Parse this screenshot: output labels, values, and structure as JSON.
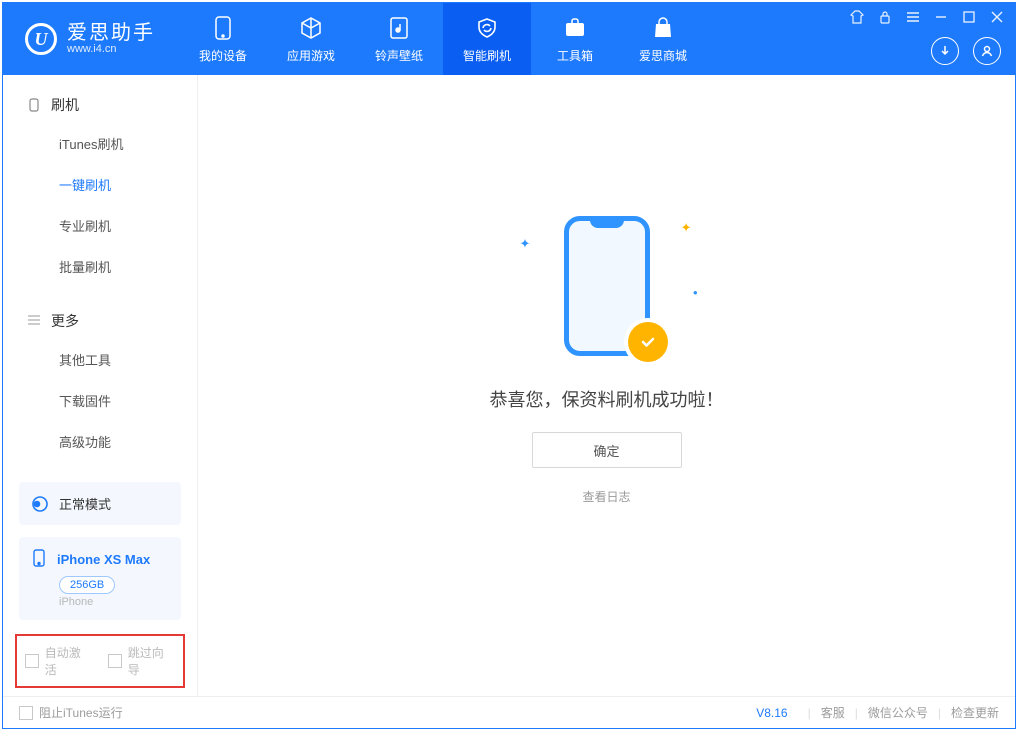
{
  "brand": {
    "logo": "U",
    "name_cn": "爱思助手",
    "name_en": "www.i4.cn"
  },
  "tabs": [
    {
      "label": "我的设备"
    },
    {
      "label": "应用游戏"
    },
    {
      "label": "铃声壁纸"
    },
    {
      "label": "智能刷机"
    },
    {
      "label": "工具箱"
    },
    {
      "label": "爱思商城"
    }
  ],
  "sidebar": {
    "sec1_title": "刷机",
    "sec1_items": [
      "iTunes刷机",
      "一键刷机",
      "专业刷机",
      "批量刷机"
    ],
    "sec2_title": "更多",
    "sec2_items": [
      "其他工具",
      "下载固件",
      "高级功能"
    ]
  },
  "mode": {
    "label": "正常模式"
  },
  "device": {
    "name": "iPhone XS Max",
    "capacity": "256GB",
    "type": "iPhone"
  },
  "options": {
    "auto_activate": "自动激活",
    "skip_guide": "跳过向导"
  },
  "main": {
    "message": "恭喜您，保资料刷机成功啦！",
    "ok": "确定",
    "view_log": "查看日志"
  },
  "status": {
    "block_itunes": "阻止iTunes运行",
    "version": "V8.16",
    "links": [
      "客服",
      "微信公众号",
      "检查更新"
    ]
  }
}
